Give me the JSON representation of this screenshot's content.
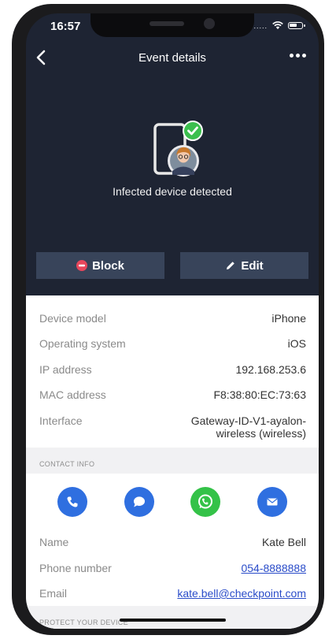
{
  "status_bar": {
    "time": "16:57",
    "signal": "....."
  },
  "header": {
    "title": "Event details"
  },
  "hero": {
    "caption": "Infected device detected"
  },
  "actions": {
    "block_label": "Block",
    "edit_label": "Edit"
  },
  "device_info": [
    {
      "label": "Device model",
      "value": "iPhone"
    },
    {
      "label": "Operating system",
      "value": "iOS"
    },
    {
      "label": "IP address",
      "value": "192.168.253.6"
    },
    {
      "label": "MAC address",
      "value": "F8:38:80:EC:73:63"
    },
    {
      "label": "Interface",
      "value_line1": "Gateway-ID-V1-ayalon-",
      "value_line2": "wireless (wireless)"
    }
  ],
  "contact_section": {
    "title": "CONTACT INFO"
  },
  "contact_icons": [
    "phone-icon",
    "chat-icon",
    "whatsapp-icon",
    "email-icon"
  ],
  "contact_info": [
    {
      "label": "Name",
      "value": "Kate Bell"
    },
    {
      "label": "Phone number",
      "value": "054-8888888"
    },
    {
      "label": "Email",
      "value": "kate.bell@checkpoint.com"
    }
  ],
  "protect_section": {
    "title": "PROTECT YOUR DEVICE"
  },
  "colors": {
    "dark_bg": "#1e2433",
    "button_bg": "#38445a",
    "accent_blue": "#2f6fe0",
    "whatsapp_green": "#34c248",
    "check_green": "#3cbf4e",
    "block_red": "#e8475c",
    "link": "#2a4cc9"
  }
}
